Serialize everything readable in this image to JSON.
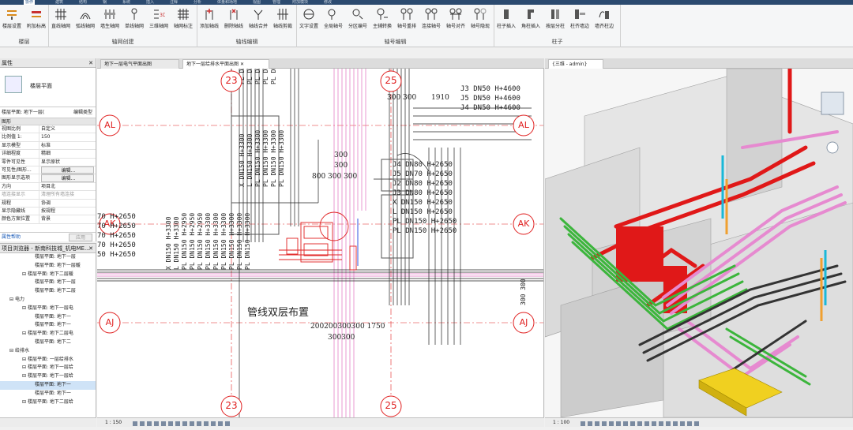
{
  "ribbon": {
    "tabs": [
      "建筑",
      "结构",
      "钢",
      "系统",
      "插入",
      "注释",
      "分析",
      "体量和场地",
      "协作",
      "视图",
      "管理",
      "附加模块",
      "修改"
    ],
    "active_tab": "协作",
    "groups": [
      {
        "label": "楼层",
        "buttons": [
          "楼层设置",
          "附加标高"
        ]
      },
      {
        "label": "轴网创建",
        "buttons": [
          "直线轴网",
          "弧线轴网",
          "墙生轴网",
          "单线轴网",
          "三维轴网",
          "轴网标注"
        ]
      },
      {
        "label": "轴线编辑",
        "buttons": [
          "添加轴线",
          "删除轴线",
          "轴线合并",
          "轴线剪裁"
        ]
      },
      {
        "label": "轴号编辑",
        "buttons": [
          "文字设置",
          "全局轴号",
          "分区编号",
          "主辅转换",
          "轴号重排",
          "连接轴号",
          "轴号对齐",
          "轴号隐现"
        ]
      },
      {
        "label": "柱子",
        "buttons": [
          "柱子插入",
          "角柱插入",
          "按层分柱",
          "柱齐墙边",
          "墙齐柱边"
        ]
      }
    ]
  },
  "properties": {
    "title": "属性",
    "type_name": "楼层平面",
    "filter_label": "楼层平面: 地下一层(",
    "edit_type": "编辑类型",
    "section_graphics": "图形",
    "rows": [
      {
        "k": "视图比例",
        "v": "自定义"
      },
      {
        "k": "比例值 1:",
        "v": "150"
      },
      {
        "k": "显示模型",
        "v": "标准"
      },
      {
        "k": "详细程度",
        "v": "精细"
      },
      {
        "k": "零件可见性",
        "v": "显示原状"
      },
      {
        "k": "可见性/图形...",
        "v": "编辑..."
      },
      {
        "k": "图形显示选项",
        "v": "编辑..."
      },
      {
        "k": "方向",
        "v": "项目北"
      },
      {
        "k": "墙连接显示",
        "v": "清理所有墙连接"
      },
      {
        "k": "规程",
        "v": "协调"
      },
      {
        "k": "显示隐藏线",
        "v": "按规程"
      },
      {
        "k": "颜色方案位置",
        "v": "背景"
      }
    ],
    "help": "属性帮助",
    "apply": "应用"
  },
  "browser": {
    "title": "项目浏览器 - 新南科技城_机电ME...",
    "items": [
      {
        "t": "楼层平面: 地下一层",
        "lvl": 3
      },
      {
        "t": "楼层平面: 地下一层暖",
        "lvl": 3
      },
      {
        "t": "楼层平面: 地下二层暖",
        "lvl": 2
      },
      {
        "t": "楼层平面: 地下一层",
        "lvl": 3
      },
      {
        "t": "楼层平面: 地下二层",
        "lvl": 3
      },
      {
        "t": "电力",
        "lvl": 1
      },
      {
        "t": "楼层平面: 地下一层电",
        "lvl": 2
      },
      {
        "t": "楼层平面: 地下一",
        "lvl": 3
      },
      {
        "t": "楼层平面: 地下一",
        "lvl": 3
      },
      {
        "t": "楼层平面: 地下二层电",
        "lvl": 2
      },
      {
        "t": "楼层平面: 地下二",
        "lvl": 3
      },
      {
        "t": "给排水",
        "lvl": 1
      },
      {
        "t": "楼层平面: 一层给排水",
        "lvl": 2
      },
      {
        "t": "楼层平面: 地下一层给",
        "lvl": 2
      },
      {
        "t": "楼层平面: 地下一层给",
        "lvl": 2
      },
      {
        "t": "楼层平面: 地下一",
        "lvl": 3
      },
      {
        "t": "楼层平面: 地下一",
        "lvl": 3
      },
      {
        "t": "楼层平面: 地下二层给",
        "lvl": 2
      }
    ]
  },
  "tabs2d": [
    {
      "label": "地下一层电气平面出图",
      "active": false
    },
    {
      "label": "地下一层给排水平面出图",
      "active": true
    }
  ],
  "tab3d": "{三维 - admin}",
  "plan": {
    "grid_labels": [
      "23",
      "25",
      "AL",
      "AK",
      "AJ"
    ],
    "annot_center": "管线双层布置",
    "pipe_labels_right": [
      "J3 DN50 H+4600",
      "J5 DN50 H+4600",
      "J4 DN50 H+4600",
      "J4 DN80 H+2650",
      "J5 DN70 H+2650",
      "J2 DN80 H+2650",
      "J3 DN80 H+2650",
      "X DN150 H+2650",
      "L DN150 H+2650",
      "PL DN150 H+2650",
      "PL DN150 H+2650"
    ],
    "pipe_labels_left": [
      "70 H+2650",
      "70 H+2650",
      "70 H+2650",
      "70 H+2650",
      "50 H+2650"
    ],
    "dims": [
      "300",
      "300",
      "800 300 300",
      "1910",
      "300 300",
      "200200300300 1750",
      "300300"
    ]
  },
  "status2d": {
    "scale": "1 : 150"
  },
  "status3d": {
    "scale": "1 : 100"
  }
}
